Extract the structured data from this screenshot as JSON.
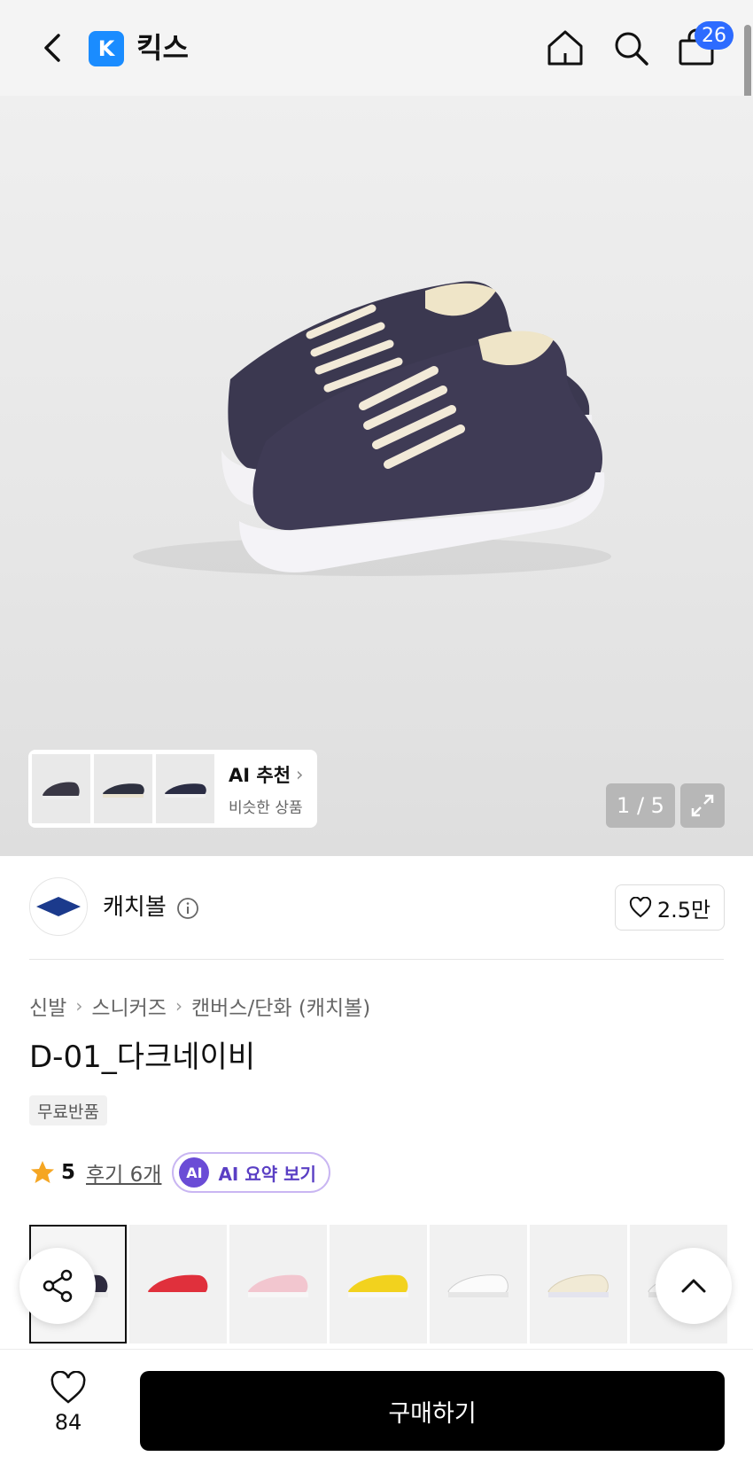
{
  "header": {
    "app_logo_letter": "K",
    "app_name": "킥스",
    "cart_count": "26"
  },
  "hero": {
    "ai_recommend": {
      "title": "AI 추천",
      "subtitle": "비슷한 상품"
    },
    "page_counter": "1 / 5"
  },
  "brand": {
    "name": "캐치볼",
    "likes": "2.5만"
  },
  "breadcrumb": [
    "신발",
    "스니커즈",
    "캔버스/단화 (캐치볼)"
  ],
  "product": {
    "title": "D-01_다크네이비",
    "tag": "무료반품"
  },
  "rating": {
    "score": "5",
    "review_link": "후기 6개",
    "ai_badge": "AI",
    "ai_summary": "AI 요약 보기"
  },
  "variants": [
    {
      "color_name": "dark-navy",
      "color": "#2e2b3f",
      "selected": true
    },
    {
      "color_name": "red",
      "color": "#e0303c",
      "selected": false
    },
    {
      "color_name": "pink",
      "color": "#f2c6cf",
      "selected": false
    },
    {
      "color_name": "yellow",
      "color": "#f2d21e",
      "selected": false
    },
    {
      "color_name": "white",
      "color": "#f7f7f7",
      "selected": false
    },
    {
      "color_name": "cream",
      "color": "#f1ead5",
      "selected": false
    },
    {
      "color_name": "dark-navy-alt",
      "color": "#3a3a48",
      "selected": false
    }
  ],
  "bottom_bar": {
    "wish_count": "84",
    "buy_label": "구매하기"
  },
  "colors": {
    "accent_blue": "#2d6bff",
    "brand_blue": "#1a8cff",
    "ai_purple": "#6a4cd6",
    "star": "#f5a623",
    "buy_button": "#000000"
  }
}
